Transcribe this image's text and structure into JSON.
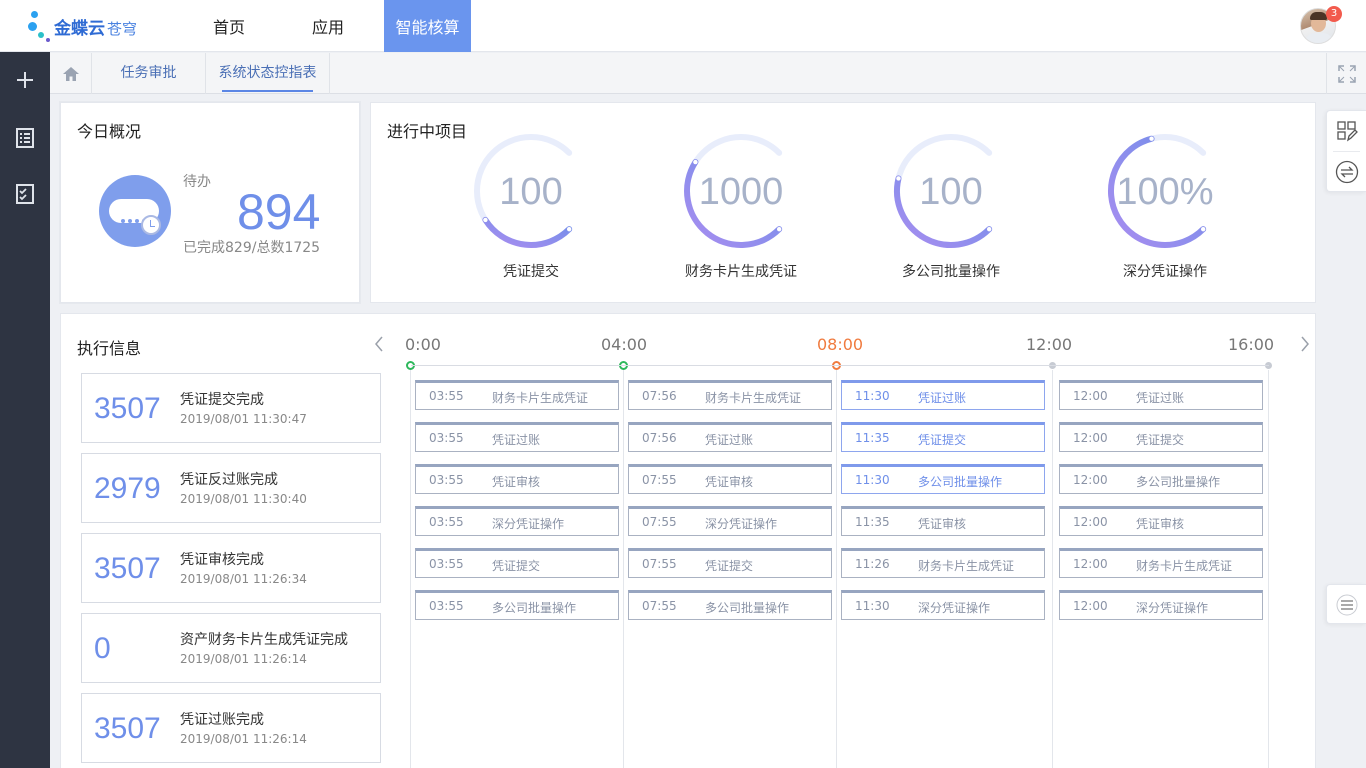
{
  "brand": {
    "name": "金蝶云",
    "sub": "苍穹"
  },
  "nav": [
    {
      "label": "首页",
      "active": false
    },
    {
      "label": "应用",
      "active": false
    },
    {
      "label": "智能核算",
      "active": true
    }
  ],
  "user": {
    "badge": "3"
  },
  "tabs": [
    {
      "label": "任务审批",
      "active": false
    },
    {
      "label": "系统状态控指表",
      "active": true
    }
  ],
  "today": {
    "title": "今日概况",
    "pending_label": "待办",
    "pending_value": "894",
    "summary": "已完成829/总数1725"
  },
  "projects": {
    "title": "进行中项目",
    "items": [
      {
        "value": "100",
        "label": "凭证提交",
        "progress": 0.38
      },
      {
        "value": "1000",
        "label": "财务卡片生成凭证",
        "progress": 0.62
      },
      {
        "value": "100",
        "label": "多公司批量操作",
        "progress": 0.55
      },
      {
        "value": "100%",
        "label": "深分凭证操作",
        "progress": 0.78
      }
    ]
  },
  "exec": {
    "title": "执行信息",
    "items": [
      {
        "num": "3507",
        "name": "凭证提交完成",
        "time": "2019/08/01  11:30:47"
      },
      {
        "num": "2979",
        "name": "凭证反过账完成",
        "time": "2019/08/01  11:30:40"
      },
      {
        "num": "3507",
        "name": "凭证审核完成",
        "time": "2019/08/01  11:26:34"
      },
      {
        "num": "0",
        "name": "资产财务卡片生成凭证完成",
        "time": "2019/08/01  11:26:14"
      },
      {
        "num": "3507",
        "name": "凭证过账完成",
        "time": "2019/08/01  11:26:14"
      }
    ]
  },
  "timeline": {
    "labels": [
      "0:00",
      "04:00",
      "08:00",
      "12:00",
      "16:00"
    ],
    "current_color": "#f07b3f",
    "columns": [
      {
        "tasks": [
          {
            "time": "03:55",
            "name": "财务卡片生成凭证"
          },
          {
            "time": "03:55",
            "name": "凭证过账"
          },
          {
            "time": "03:55",
            "name": "凭证审核"
          },
          {
            "time": "03:55",
            "name": "深分凭证操作"
          },
          {
            "time": "03:55",
            "name": "凭证提交"
          },
          {
            "time": "03:55",
            "name": "多公司批量操作"
          }
        ]
      },
      {
        "tasks": [
          {
            "time": "07:56",
            "name": "财务卡片生成凭证"
          },
          {
            "time": "07:56",
            "name": "凭证过账"
          },
          {
            "time": "07:55",
            "name": "凭证审核"
          },
          {
            "time": "07:55",
            "name": "深分凭证操作"
          },
          {
            "time": "07:55",
            "name": "凭证提交"
          },
          {
            "time": "07:55",
            "name": "多公司批量操作"
          }
        ]
      },
      {
        "tasks": [
          {
            "time": "11:30",
            "name": "凭证过账",
            "highlight": true
          },
          {
            "time": "11:35",
            "name": "凭证提交",
            "highlight": true
          },
          {
            "time": "11:30",
            "name": "多公司批量操作",
            "highlight": true
          },
          {
            "time": "11:35",
            "name": "凭证审核"
          },
          {
            "time": "11:26",
            "name": "财务卡片生成凭证"
          },
          {
            "time": "11:30",
            "name": "深分凭证操作"
          }
        ]
      },
      {
        "tasks": [
          {
            "time": "12:00",
            "name": "凭证过账"
          },
          {
            "time": "12:00",
            "name": "凭证提交"
          },
          {
            "time": "12:00",
            "name": "多公司批量操作"
          },
          {
            "time": "12:00",
            "name": "凭证审核"
          },
          {
            "time": "12:00",
            "name": "财务卡片生成凭证"
          },
          {
            "time": "12:00",
            "name": "深分凭证操作"
          }
        ]
      }
    ]
  }
}
